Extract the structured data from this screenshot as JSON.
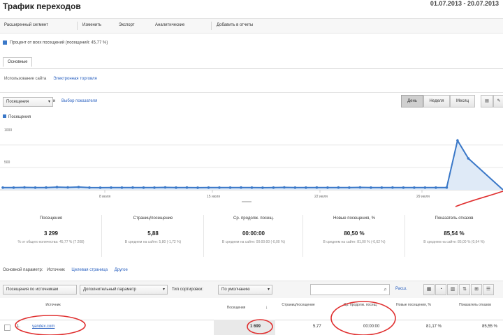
{
  "header": {
    "title": "Трафик переходов",
    "date_range": "01.07.2013 - 20.07.2013"
  },
  "toolbar": {
    "items": [
      "Расширенный сегмент",
      "Изменить",
      "Экспорт",
      "Аналитические",
      "Добавить в отчеты"
    ]
  },
  "segment": {
    "label": "Процент от всех посещений (посещений: 45,77 %)"
  },
  "tabs": {
    "active": "Основные"
  },
  "subtabs": {
    "label": "Использование сайта",
    "link": "Электронная торговля"
  },
  "chart_controls": {
    "metric_select": "Посещения",
    "vs_label": "и",
    "choose_metric": "Выбор показателя",
    "views": [
      "День",
      "Неделя",
      "Месяц"
    ]
  },
  "legend": {
    "label": "Посещения"
  },
  "chart_data": {
    "type": "area",
    "series": [
      {
        "name": "Посещения",
        "values": [
          50,
          50,
          55,
          50,
          52,
          60,
          55,
          62,
          50,
          48,
          50,
          50,
          52,
          50,
          50,
          55,
          50,
          52,
          48,
          50,
          50,
          50,
          52,
          50,
          48,
          50,
          55,
          50,
          50,
          52,
          50,
          52,
          50,
          55,
          50,
          50,
          52,
          50,
          50,
          50,
          50,
          52,
          1100,
          700
        ]
      }
    ],
    "y_ticks": [
      "1000",
      "500"
    ],
    "x_ticks": [
      "8 июля",
      "15 июля",
      "22 июля",
      "29 июля"
    ],
    "ylim": [
      0,
      1400
    ],
    "grid": true,
    "colors": {
      "line": "#3a78c8",
      "fill": "#dfeaf7"
    }
  },
  "metrics": [
    {
      "name": "Посещения",
      "value": "3 299",
      "sub": "% от общего количества: 45,77 % (7 208)"
    },
    {
      "name": "Страниц/посещение",
      "value": "5,88",
      "sub": "В среднем на сайте: 5,80 (-1,72 %)"
    },
    {
      "name": "Ср. продолж. посещ.",
      "value": "00:00:00",
      "sub": "В среднем на сайте: 00:00:00 (-0,00 %)"
    },
    {
      "name": "Новые посещения, %",
      "value": "80,50 %",
      "sub": "В среднем на сайте: 81,00 % (-0,62 %)"
    },
    {
      "name": "Показатель отказов",
      "value": "85,54 %",
      "sub": "В среднем на сайте: 85,00 % (0,64 %)"
    }
  ],
  "dimensions": {
    "label": "Основной параметр:",
    "primary": "Источник",
    "links": [
      "Целевая страница",
      "Другое"
    ]
  },
  "table_controls": {
    "secondary": "Посещения по источникам",
    "secondary_param": "Дополнительный параметр",
    "sort_label": "Тип сортировки:",
    "sort_value": "По умолчанию",
    "advanced_link": "Расш.",
    "view_icons": [
      "grid-icon",
      "pie-icon",
      "bar-icon",
      "compare-icon",
      "pivot-icon",
      "list-icon"
    ]
  },
  "table": {
    "headers": [
      "Источник",
      "Посещения",
      "Страниц/посещение",
      "Ср. продолж. посещ.",
      "Новые посещения, %",
      "Показатель отказов"
    ],
    "rows": [
      {
        "index": "1.",
        "source": "yandex.com",
        "visits": "1 699",
        "pages": "5,77",
        "duration": "00:00:00",
        "new_pct": "81,17 %",
        "bounce": "85,55 %"
      }
    ]
  }
}
